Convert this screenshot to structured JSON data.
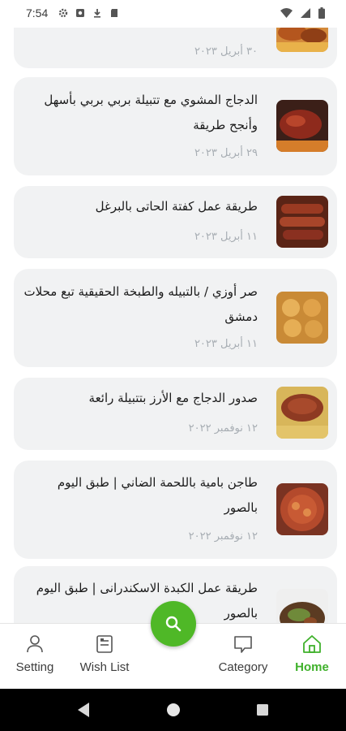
{
  "status_bar": {
    "time": "7:54",
    "left_icons": [
      "settings-icon",
      "media-icon",
      "download-icon",
      "sd-card-icon"
    ],
    "right_icons": [
      "wifi-icon",
      "signal-icon",
      "battery-icon"
    ]
  },
  "posts": [
    {
      "title": "",
      "date": "٣٠ أبريل ٢٠٢٣"
    },
    {
      "title": "الدجاج المشوي مع تتبيلة بربي بربي بأسهل وأنجح طريقة",
      "date": "٢٩ أبريل ٢٠٢٣"
    },
    {
      "title": "طريقة عمل كفتة الحاتى بالبرغل",
      "date": "١١ أبريل ٢٠٢٣"
    },
    {
      "title": "صر أوزي / بالتبيله والطبخة الحقيقية تبع محلات دمشق",
      "date": "١١ أبريل ٢٠٢٣"
    },
    {
      "title": "صدور الدجاج مع الأرز بتتبيلة رائعة",
      "date": "١٢ نوفمبر ٢٠٢٢"
    },
    {
      "title": "طاجن بامية باللحمة الضاني | طبق اليوم بالصور",
      "date": "١٢ نوفمبر ٢٠٢٢"
    },
    {
      "title": "طريقة عمل الكبدة الاسكندرانى | طبق اليوم بالصور",
      "date": ""
    }
  ],
  "bottom_nav": {
    "items": [
      {
        "label": "Setting",
        "icon": "user-icon"
      },
      {
        "label": "Wish List",
        "icon": "wishlist-icon"
      },
      {
        "label": "Category",
        "icon": "chat-bubble-icon"
      },
      {
        "label": "Home",
        "icon": "home-icon"
      }
    ],
    "active": "Home",
    "fab_icon": "search-icon"
  },
  "colors": {
    "accent": "#4fb827",
    "card_bg": "#f1f2f3",
    "date_text": "#a7adb3",
    "active_nav": "#3fb12b"
  },
  "system_nav": {
    "buttons": [
      "back-icon",
      "home-circle-icon",
      "recents-icon"
    ]
  }
}
